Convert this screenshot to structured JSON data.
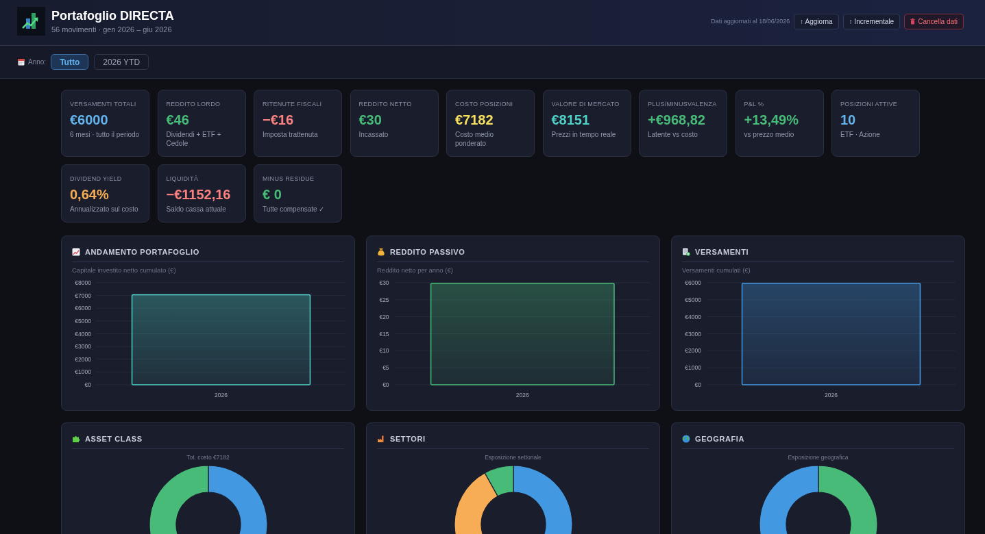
{
  "header": {
    "title": "Portafoglio DIRECTA",
    "subtitle": "56 movimenti · gen 2026 – giu 2026",
    "updated": "Dati aggiornati al 18/06/2026",
    "buttons": [
      {
        "label": "↑ Aggiorna",
        "kind": "default"
      },
      {
        "label": "↑ Incrementale",
        "kind": "default"
      },
      {
        "label": "Cancella dati",
        "kind": "danger"
      }
    ]
  },
  "year_filter": {
    "label": "Anno:",
    "options": [
      {
        "label": "Tutto",
        "selected": true
      },
      {
        "label": "2026 YTD",
        "selected": false
      }
    ]
  },
  "kpis": [
    {
      "label": "VERSAMENTI TOTALI",
      "value": "€6000",
      "note": "6 mesi · tutto il periodo",
      "color": "#63b3ed"
    },
    {
      "label": "REDDITO LORDO",
      "value": "€46",
      "note": "Dividendi + ETF + Cedole",
      "color": "#48bb78"
    },
    {
      "label": "RITENUTE FISCALI",
      "value": "−€16",
      "note": "Imposta trattenuta",
      "color": "#fc8181"
    },
    {
      "label": "REDDITO NETTO",
      "value": "€30",
      "note": "Incassato",
      "color": "#48bb78"
    },
    {
      "label": "COSTO POSIZIONI",
      "value": "€7182",
      "note": "Costo medio ponderato",
      "color": "#f6e05e"
    },
    {
      "label": "VALORE DI MERCATO",
      "value": "€8151",
      "note": "Prezzi in tempo reale",
      "color": "#4fd1c5"
    },
    {
      "label": "PLUS/MINUSVALENZA",
      "value": "+€968,82",
      "note": "Latente vs costo",
      "color": "#48bb78"
    },
    {
      "label": "P&L %",
      "value": "+13,49%",
      "note": "vs prezzo medio",
      "color": "#48bb78"
    },
    {
      "label": "POSIZIONI ATTIVE",
      "value": "10",
      "note": "ETF · Azione",
      "color": "#63b3ed"
    },
    {
      "label": "DIVIDEND YIELD",
      "value": "0,64%",
      "note": "Annualizzato sul costo",
      "color": "#f6ad55"
    },
    {
      "label": "LIQUIDITÀ",
      "value": "−€1152,16",
      "note": "Saldo cassa attuale",
      "color": "#fc8181"
    },
    {
      "label": "MINUS RESIDUE",
      "value": "€ 0",
      "note": "Tutte compensate ✓",
      "color": "#48bb78"
    }
  ],
  "chart_cards": [
    {
      "kind": "bar",
      "title": "ANDAMENTO PORTAFOGLIO",
      "chart_data": {
        "type": "bar",
        "title": "Capitale investito netto cumulato (€)",
        "categories": [
          "2026"
        ],
        "series": [
          {
            "color": "#4fd1c5",
            "values": [
              7100
            ]
          }
        ],
        "ylim": [
          0,
          8000
        ],
        "yticks": [
          {
            "value": 0,
            "label": "€0"
          },
          {
            "value": 1000,
            "label": "€1000"
          },
          {
            "value": 2000,
            "label": "€2000"
          },
          {
            "value": 3000,
            "label": "€3000"
          },
          {
            "value": 4000,
            "label": "€4000"
          },
          {
            "value": 5000,
            "label": "€5000"
          },
          {
            "value": 6000,
            "label": "€6000"
          },
          {
            "value": 7000,
            "label": "€7000"
          },
          {
            "value": 8000,
            "label": "€8000"
          }
        ],
        "grid": true
      }
    },
    {
      "kind": "bar",
      "title": "REDDITO PASSIVO",
      "chart_data": {
        "type": "bar",
        "title": "Reddito netto per anno (€)",
        "categories": [
          "2026"
        ],
        "series": [
          {
            "color": "#48bb78",
            "values": [
              30
            ]
          }
        ],
        "ylim": [
          0,
          30
        ],
        "yticks": [
          {
            "value": 0,
            "label": "€0"
          },
          {
            "value": 5,
            "label": "€5"
          },
          {
            "value": 10,
            "label": "€10"
          },
          {
            "value": 15,
            "label": "€15"
          },
          {
            "value": 20,
            "label": "€20"
          },
          {
            "value": 25,
            "label": "€25"
          },
          {
            "value": 30,
            "label": "€30"
          }
        ],
        "grid": true
      }
    },
    {
      "kind": "bar",
      "title": "VERSAMENTI",
      "chart_data": {
        "type": "bar",
        "title": "Versamenti cumulati (€)",
        "categories": [
          "2026"
        ],
        "series": [
          {
            "color": "#4299e1",
            "values": [
              6000
            ]
          }
        ],
        "ylim": [
          0,
          6000
        ],
        "yticks": [
          {
            "value": 0,
            "label": "€0"
          },
          {
            "value": 1000,
            "label": "€1000"
          },
          {
            "value": 2000,
            "label": "€2000"
          },
          {
            "value": 3000,
            "label": "€3000"
          },
          {
            "value": 4000,
            "label": "€4000"
          },
          {
            "value": 5000,
            "label": "€5000"
          },
          {
            "value": 6000,
            "label": "€6000"
          }
        ],
        "grid": true
      }
    },
    {
      "kind": "donut",
      "title": "ASSET CLASS",
      "subtitle": "Tot. costo €7182"
    },
    {
      "kind": "donut",
      "title": "SETTORI",
      "subtitle": "Esposizione settoriale"
    },
    {
      "kind": "donut",
      "title": "GEOGRAFIA",
      "subtitle": "Esposizione geografica"
    }
  ]
}
